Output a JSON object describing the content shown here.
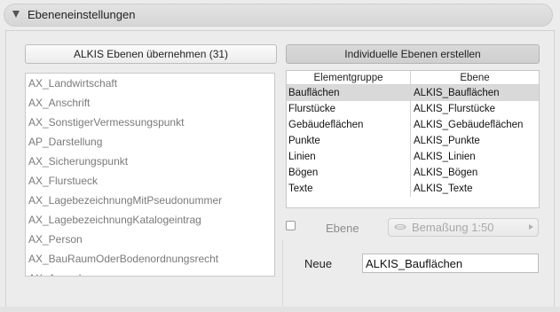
{
  "section": {
    "title": "Ebeneneinstellungen"
  },
  "buttons": {
    "import_label": "ALKIS Ebenen übernehmen (31)",
    "create_label": "Individuelle Ebenen erstellen"
  },
  "layer_list": {
    "items": [
      "AX_Landwirtschaft",
      "AX_Anschrift",
      "AX_SonstigerVermessungspunkt",
      "AP_Darstellung",
      "AX_Sicherungspunkt",
      "AX_Flurstueck",
      "AX_LagebezeichnungMitPseudonummer",
      "AX_LagebezeichnungKatalogeintrag",
      "AX_Person",
      "AX_BauRaumOderBodenordnungsrecht",
      "AX_Ausgabe…"
    ]
  },
  "mapping_table": {
    "columns": [
      "Elementgruppe",
      "Ebene"
    ],
    "rows": [
      {
        "group": "Bauflächen",
        "layer": "ALKIS_Bauflächen",
        "selected": true
      },
      {
        "group": "Flurstücke",
        "layer": "ALKIS_Flurstücke",
        "selected": false
      },
      {
        "group": "Gebäudeflächen",
        "layer": "ALKIS_Gebäudeflächen",
        "selected": false
      },
      {
        "group": "Punkte",
        "layer": "ALKIS_Punkte",
        "selected": false
      },
      {
        "group": "Linien",
        "layer": "ALKIS_Linien",
        "selected": false
      },
      {
        "group": "Bögen",
        "layer": "ALKIS_Bögen",
        "selected": false
      },
      {
        "group": "Texte",
        "layer": "ALKIS_Texte",
        "selected": false
      }
    ]
  },
  "ebene": {
    "checkbox_checked": false,
    "label": "Ebene",
    "selected_value": "Bemaßung 1:50"
  },
  "new_layer": {
    "label": "Neue",
    "value": "ALKIS_Bauflächen"
  }
}
